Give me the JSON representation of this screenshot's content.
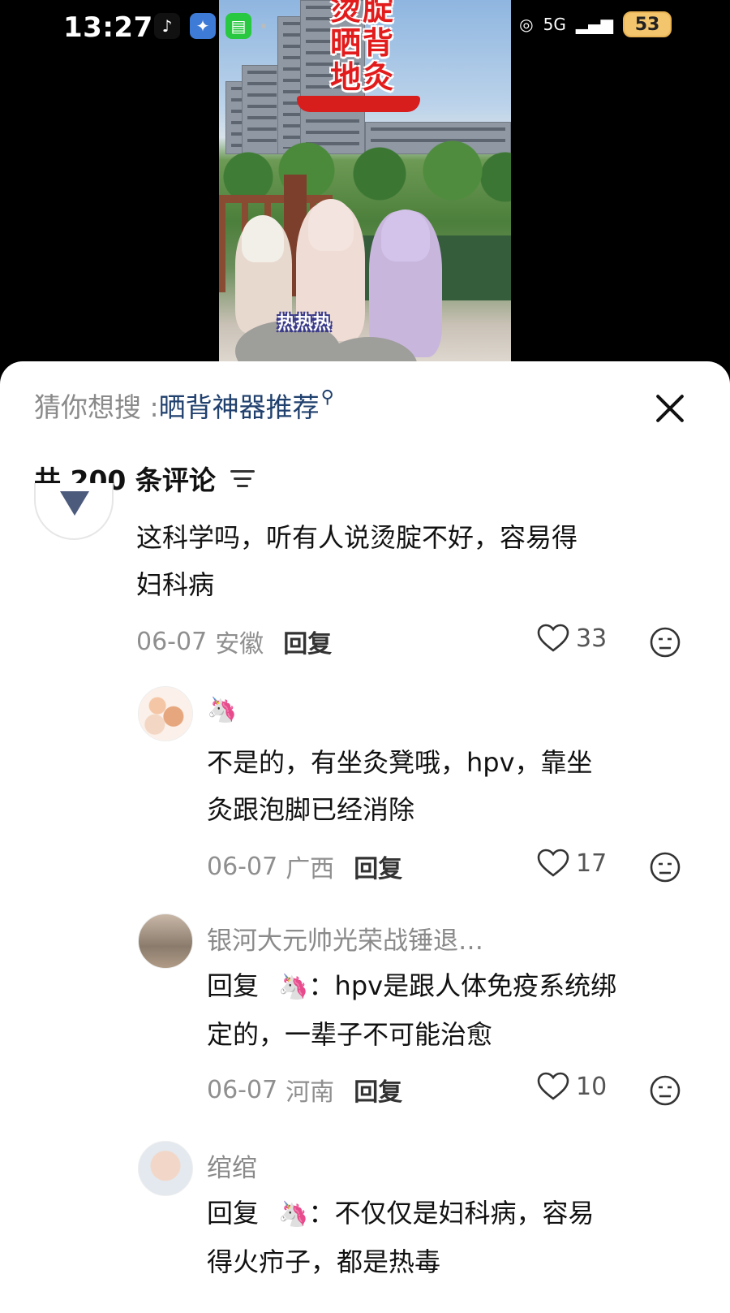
{
  "status": {
    "time": "13:27",
    "apps": [
      "tiktok-icon",
      "game-icon",
      "message-icon"
    ],
    "network": "5G",
    "battery": "53"
  },
  "video": {
    "banner_lines": [
      "烫腚",
      "晒背",
      "地灸"
    ],
    "caption": "热热热"
  },
  "search_suggest": {
    "label": "猜你想搜 : ",
    "query": "晒背神器推荐"
  },
  "comments_header": {
    "count_text": "共 200 条评论"
  },
  "comments": [
    {
      "text_line1": "这科学吗，听有人说烫腚不好，容易得",
      "text_line2": "妇科病",
      "date": "06-07",
      "location": "安徽",
      "reply_label": "回复",
      "likes": "33"
    },
    {
      "username": "🦄",
      "text_line1": "不是的，有坐灸凳哦，hpv，靠坐",
      "text_line2": "灸跟泡脚已经消除",
      "date": "06-07",
      "location": "广西",
      "reply_label": "回复",
      "likes": "17"
    },
    {
      "username": "银河大元帅光荣战锤退…",
      "reply_prefix": "回复",
      "reply_to": "🦄",
      "text_line1": "：hpv是跟人体免疫系统绑",
      "text_line2": "定的，一辈子不可能治愈",
      "date": "06-07",
      "location": "河南",
      "reply_label": "回复",
      "likes": "10"
    },
    {
      "username": "绾绾",
      "reply_prefix": "回复",
      "reply_to": "🦄",
      "text_line1": "：不仅仅是妇科病，容易",
      "text_line2": "得火疖子，都是热毒"
    }
  ]
}
